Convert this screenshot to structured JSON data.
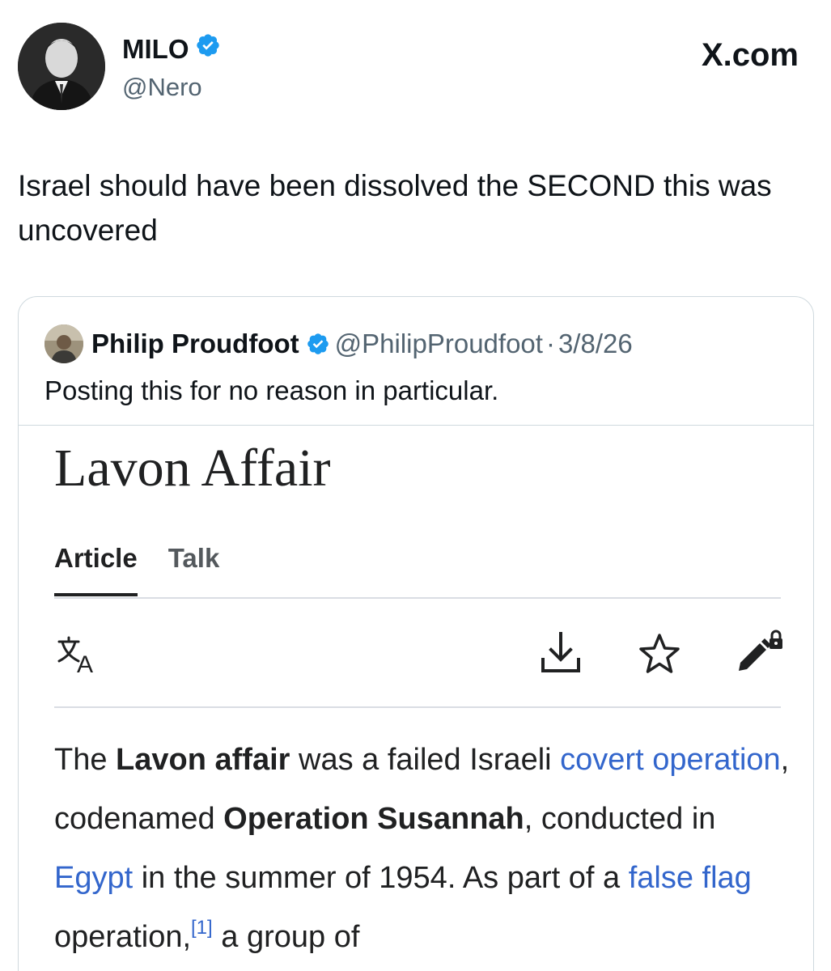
{
  "author": {
    "name": "MILO",
    "handle": "@Nero",
    "verified": true
  },
  "site_label": "X.com",
  "tweet": {
    "text": "Israel should have been dissolved the SECOND this was uncovered"
  },
  "quoted_tweet": {
    "name": "Philip Proudfoot",
    "handle": "@PhilipProudfoot",
    "separator": "·",
    "date": "3/8/26",
    "text": "Posting this for no reason in particular."
  },
  "wiki": {
    "title": "Lavon Affair",
    "tabs": [
      {
        "label": "Article",
        "active": true
      },
      {
        "label": "Talk",
        "active": false
      }
    ],
    "toolbar_icons": [
      "translate-icon",
      "download-icon",
      "star-icon",
      "edit-lock-icon"
    ],
    "body": {
      "s1": "The ",
      "b1": "Lavon affair",
      "s2": " was a failed Israeli ",
      "link1": "covert operation",
      "s3": ", codenamed ",
      "b2": "Operation Susannah",
      "s4": ", conducted in ",
      "link2": "Egypt",
      "s5": " in the summer of 1954. As part of a ",
      "link3": "false flag",
      "s6": " operation,",
      "ref1": "[1]",
      "s7": " a group of"
    }
  },
  "colors": {
    "verified_blue": "#1d9bf0",
    "link_blue": "#3366cc",
    "secondary_text": "#536471",
    "border": "#cfd9de"
  }
}
